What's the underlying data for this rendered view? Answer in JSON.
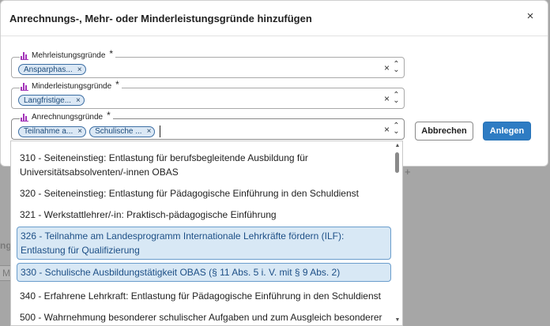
{
  "background": {
    "ghost_label": "ng",
    "ghost_input": "Mi",
    "plus": "+"
  },
  "modal": {
    "title": "Anrechnungs-, Mehr- oder Minderleistungsgründe hinzufügen",
    "close": "×"
  },
  "fields": {
    "mehr": {
      "label": "Mehrleistungsgründe",
      "required": "*",
      "chips": [
        "Ansparphas..."
      ]
    },
    "minder": {
      "label": "Minderleistungsgründe",
      "required": "*",
      "chips": [
        "Langfristige..."
      ]
    },
    "anrechnung": {
      "label": "Anrechnungsgründe",
      "required": "*",
      "chips": [
        "Teilnahme a...",
        "Schulische ..."
      ]
    }
  },
  "controls": {
    "chip_remove": "×",
    "clear": "×",
    "toggle_up": "⌃",
    "toggle_down": "⌄"
  },
  "buttons": {
    "cancel": "Abbrechen",
    "create": "Anlegen"
  },
  "dropdown": {
    "options": [
      {
        "text": "310 - Seiteneinstieg: Entlastung für berufsbegleitende Ausbildung für Universitätsabsolventen/-innen OBAS",
        "selected": false
      },
      {
        "text": "320 - Seiteneinstieg: Entlastung für Pädagogische Einführung in den Schuldienst",
        "selected": false
      },
      {
        "text": "321 - Werkstattlehrer/-in: Praktisch-pädagogische Einführung",
        "selected": false
      },
      {
        "text": "326 - Teilnahme am Landesprogramm Internationale Lehrkräfte fördern (ILF): Entlastung für Qualifizierung",
        "selected": true
      },
      {
        "text": "330 - Schulische Ausbildungstätigkeit OBAS (§ 11 Abs. 5 i. V. mit § 9 Abs. 2)",
        "selected": true
      },
      {
        "text": "340 - Erfahrene Lehrkraft: Entlastung für Pädagogische Einführung in den Schuldienst",
        "selected": false
      },
      {
        "text": "500 - Wahrnehmung besonderer schulischer Aufgaben und zum Ausgleich besonderer",
        "selected": false
      }
    ],
    "scroll_up": "▲",
    "scroll_down": "▼"
  },
  "colors": {
    "accent": "#2e7cc3",
    "chip_bg": "#dbe8f5",
    "selected_bg": "#d8e8f5",
    "icon": "#a334b8"
  }
}
